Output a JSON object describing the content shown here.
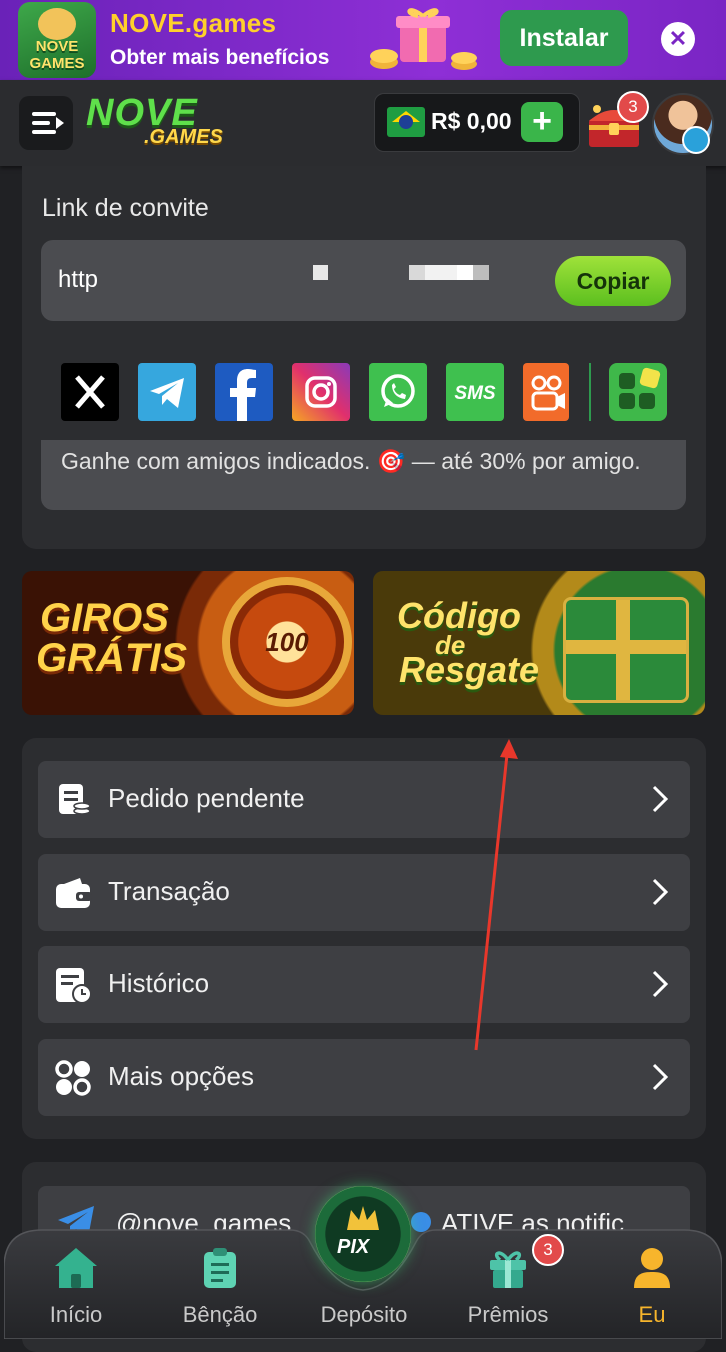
{
  "banner": {
    "app_icon_text": "NOVE GAMES",
    "title": "NOVE.games",
    "subtitle": "Obter mais benefícios",
    "install_label": "Instalar",
    "close_symbol": "✕"
  },
  "header": {
    "logo_main": "NOVE",
    "logo_sub": ".GAMES",
    "balance": "R$ 0,00",
    "plus_symbol": "+",
    "treasure_badge": "3"
  },
  "invite": {
    "label": "Link de convite",
    "link_text": "http",
    "copy_label": "Copiar",
    "earn_text": "Ganhe com amigos indicados. 🎯 — até 30% por amigo.",
    "social_icons": [
      "x-icon",
      "telegram-icon",
      "facebook-icon",
      "instagram-icon",
      "whatsapp-icon",
      "sms-icon",
      "kwai-icon",
      "more-apps-icon"
    ],
    "sms_text": "SMS"
  },
  "promos": {
    "left_line1": "GIROS",
    "left_line2": "GRÁTIS",
    "wheel_value": "100",
    "right_line1": "Código",
    "right_line2": "de",
    "right_line3": "Resgate"
  },
  "menu": {
    "items": [
      {
        "label": "Pedido pendente",
        "icon": "pending-order-icon"
      },
      {
        "label": "Transação",
        "icon": "wallet-icon"
      },
      {
        "label": "Histórico",
        "icon": "history-icon"
      },
      {
        "label": "Mais opções",
        "icon": "more-options-icon"
      }
    ]
  },
  "channel": {
    "handle": "@nove_games",
    "notice": "ATIVE as notific"
  },
  "nav": {
    "items": [
      {
        "label": "Início",
        "icon": "home-icon"
      },
      {
        "label": "Bênção",
        "icon": "clipboard-icon"
      },
      {
        "label": "Depósito",
        "icon": "pix-deposit-icon"
      },
      {
        "label": "Prêmios",
        "icon": "gift-icon"
      },
      {
        "label": "Eu",
        "icon": "user-icon"
      }
    ],
    "pix_label": "PIX",
    "prizes_badge": "3",
    "active_index": 4
  },
  "colors": {
    "banner_bg": "#7a25c4",
    "accent_green": "#3ab54a",
    "active_nav": "#f7b52c",
    "badge_red": "#e24a4a",
    "annotation_arrow": "#e8372b"
  }
}
